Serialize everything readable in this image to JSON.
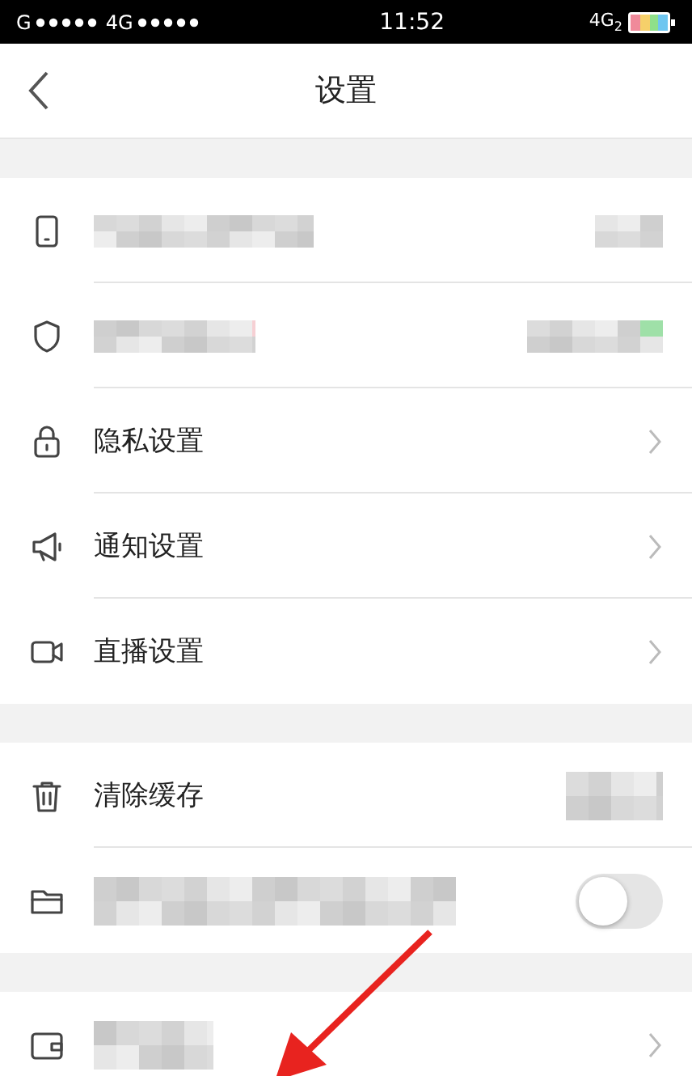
{
  "status_bar": {
    "carrier": "G",
    "network": "4G",
    "time": "11:52",
    "network_right": "4G",
    "sim": "2"
  },
  "header": {
    "title": "设置"
  },
  "sections": [
    {
      "rows": [
        {
          "kind": "masked"
        },
        {
          "kind": "masked"
        },
        {
          "kind": "link",
          "label": "隐私设置"
        },
        {
          "kind": "link",
          "label": "通知设置"
        },
        {
          "kind": "link",
          "label": "直播设置"
        }
      ]
    },
    {
      "rows": [
        {
          "kind": "masked_value",
          "label": "清除缓存"
        },
        {
          "kind": "toggle",
          "on": false
        }
      ]
    },
    {
      "rows": [
        {
          "kind": "masked_link"
        }
      ]
    }
  ],
  "annotation": {
    "kind": "arrow"
  }
}
